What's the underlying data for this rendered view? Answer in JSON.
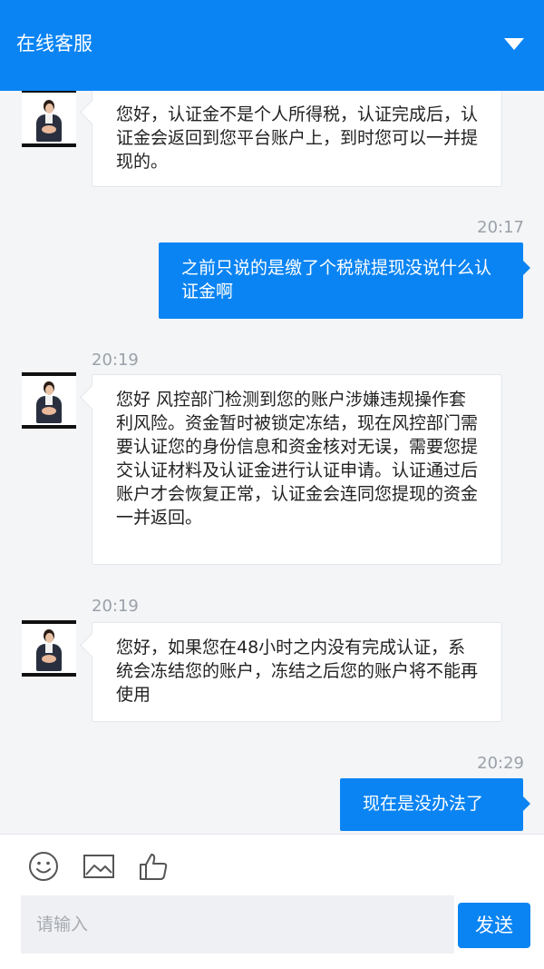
{
  "header": {
    "title": "在线客服",
    "dropdown_icon": "caret-down-icon"
  },
  "messages": [
    {
      "direction": "incoming",
      "time": "",
      "text": "您好，认证金不是个人所得税，认证完成后，认证金会返回到您平台账户上，到时您可以一并提现的。"
    },
    {
      "direction": "outgoing",
      "time": "20:17",
      "text": "之前只说的是缴了个税就提现没说什么认证金啊"
    },
    {
      "direction": "incoming",
      "time": "20:19",
      "text": "您好 风控部门检测到您的账户涉嫌违规操作套利风险。资金暂时被锁定冻结，现在风控部门需要认证您的身份信息和资金核对无误，需要您提交认证材料及认证金进行认证申请。认证通过后账户才会恢复正常，认证金会连同您提现的资金一并返回。"
    },
    {
      "direction": "incoming",
      "time": "20:19",
      "text": "您好，如果您在48小时之内没有完成认证，系统会冻结您的账户，冻结之后您的账户将不能再使用"
    },
    {
      "direction": "outgoing",
      "time": "20:29",
      "text": "现在是没办法了"
    }
  ],
  "toolbar": {
    "icons": [
      "emoji-icon",
      "image-icon",
      "thumbs-up-icon"
    ]
  },
  "composer": {
    "placeholder": "请输入",
    "send_label": "发送"
  },
  "colors": {
    "primary": "#0a84f3",
    "background": "#f4f5f7",
    "timestamp": "#9aa1a9"
  }
}
